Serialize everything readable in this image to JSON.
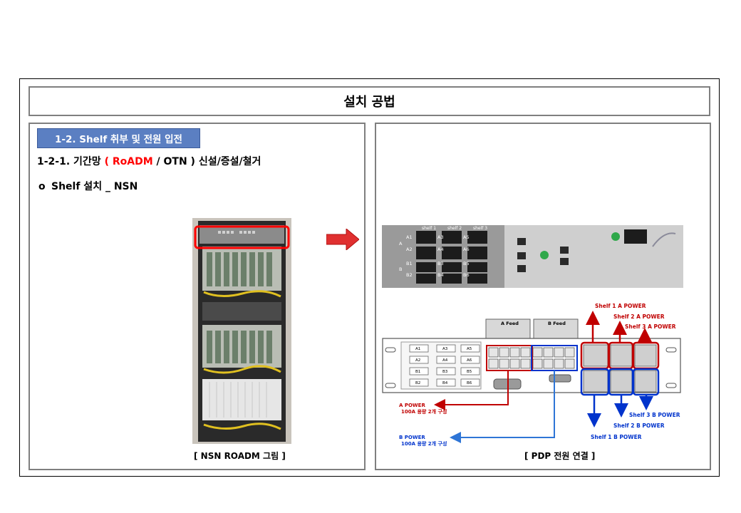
{
  "slide": {
    "title": "설치 공법",
    "section_tag": "1-2. Shelf 취부 및 전원 입전",
    "subheading": {
      "prefix": "1-2-1. 기간망 ",
      "paren_open": "( ",
      "highlight": "RoADM",
      "middle": " / OTN ) 신설/증설/철거"
    },
    "bullet": {
      "marker": "o",
      "text": "Shelf 설치 _ NSN"
    },
    "left_caption": "[ NSN ROADM 그림 ]",
    "right_caption": "[ PDP 전원 연결 ]"
  },
  "front_panel": {
    "shelf_labels": [
      "shelf 1",
      "shelf 2",
      "shelf 3"
    ],
    "feed_letters": [
      "A",
      "B"
    ],
    "breakers": [
      "A1",
      "A3",
      "A5",
      "A2",
      "A4",
      "A6",
      "B1",
      "B3",
      "B5",
      "B2",
      "B4",
      "B6"
    ]
  },
  "pdp": {
    "feed_labels": [
      "A Feed",
      "B Feed"
    ],
    "breaker_labels": [
      "A1",
      "A3",
      "A5",
      "A2",
      "A4",
      "A6",
      "B1",
      "B3",
      "B5",
      "B2",
      "B4",
      "B6"
    ],
    "annotations": {
      "shelf1_a": "Shelf 1 A POWER",
      "shelf2_a": "Shelf 2 A POWER",
      "shelf3_a": "Shelf 3 A POWER",
      "shelf3_b": "Shelf 3 B POWER",
      "shelf2_b": "Shelf 2 B POWER",
      "shelf1_b": "Shelf 1 B POWER",
      "a_power": "A POWER",
      "a_power_note": "100A 용량 2개 구성",
      "b_power": "B POWER",
      "b_power_note": "100A 용량 2개 구성"
    }
  },
  "colors": {
    "a_power": "#c00000",
    "b_power": "#0033cc",
    "b_line": "#2e75d6",
    "tag_fill": "#5b7fc2",
    "panel_border": "#7f7f7f",
    "arrow": "#e03030"
  }
}
